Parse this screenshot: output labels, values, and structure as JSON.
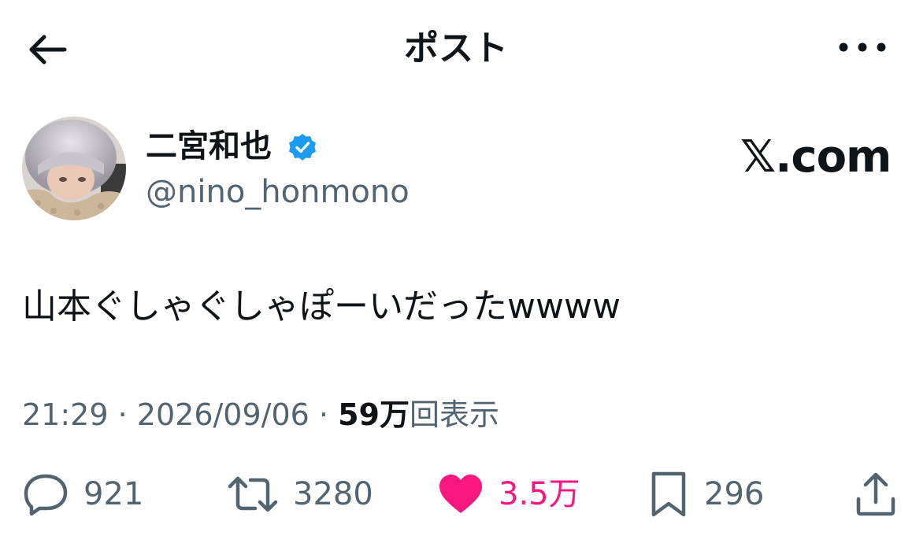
{
  "header": {
    "title": "ポスト"
  },
  "author": {
    "display_name": "二宮和也",
    "handle": "@nino_honmono",
    "verified": true
  },
  "brand": {
    "watermark": "𝕏.com"
  },
  "post": {
    "text": "山本ぐしゃぐしゃぽーいだったwwww"
  },
  "meta": {
    "time": "21:29",
    "separator": "·",
    "date": "2026/09/06",
    "views_count": "59万",
    "views_label": "回表示"
  },
  "actions": {
    "reply_count": "921",
    "retweet_count": "3280",
    "like_count": "3.5万",
    "bookmark_count": "296"
  },
  "colors": {
    "like_pink": "#f91880",
    "verified_blue": "#1d9bf0",
    "muted_gray": "#536471",
    "text_dark": "#0f1419"
  },
  "icons": [
    "back-arrow-icon",
    "more-dots-icon",
    "verified-badge-icon",
    "reply-icon",
    "retweet-icon",
    "heart-icon",
    "bookmark-icon",
    "share-icon"
  ]
}
